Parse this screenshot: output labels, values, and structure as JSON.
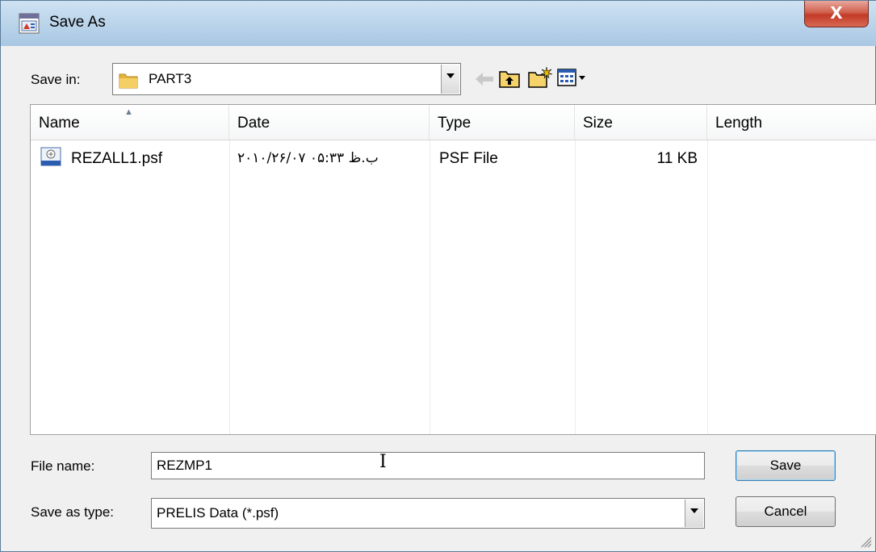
{
  "window": {
    "title": "Save As",
    "close_glyph": "X"
  },
  "toolbar": {
    "save_in_label": "Save in:",
    "location": "PART3",
    "icons": [
      "back-arrow-icon",
      "up-folder-icon",
      "new-folder-icon",
      "view-menu-icon"
    ]
  },
  "filelist": {
    "columns": [
      "Name",
      "Date",
      "Type",
      "Size",
      "Length"
    ],
    "sort_column": "Name",
    "rows": [
      {
        "name": "REZALL1.psf",
        "date": "۲۰۱۰/۲۶/۰۷ ب.ظ ۰۵:۳۳",
        "type": "PSF File",
        "size": "11 KB",
        "length": ""
      }
    ]
  },
  "form": {
    "file_name_label": "File name:",
    "file_name_value": "REZMP1",
    "save_type_label": "Save as type:",
    "save_type_value": "PRELIS Data (*.psf)",
    "save_button": "Save",
    "cancel_button": "Cancel"
  },
  "colors": {
    "titlebar": "#b9d3ea",
    "close_button": "#c23a26",
    "folder": "#e6b43c"
  }
}
